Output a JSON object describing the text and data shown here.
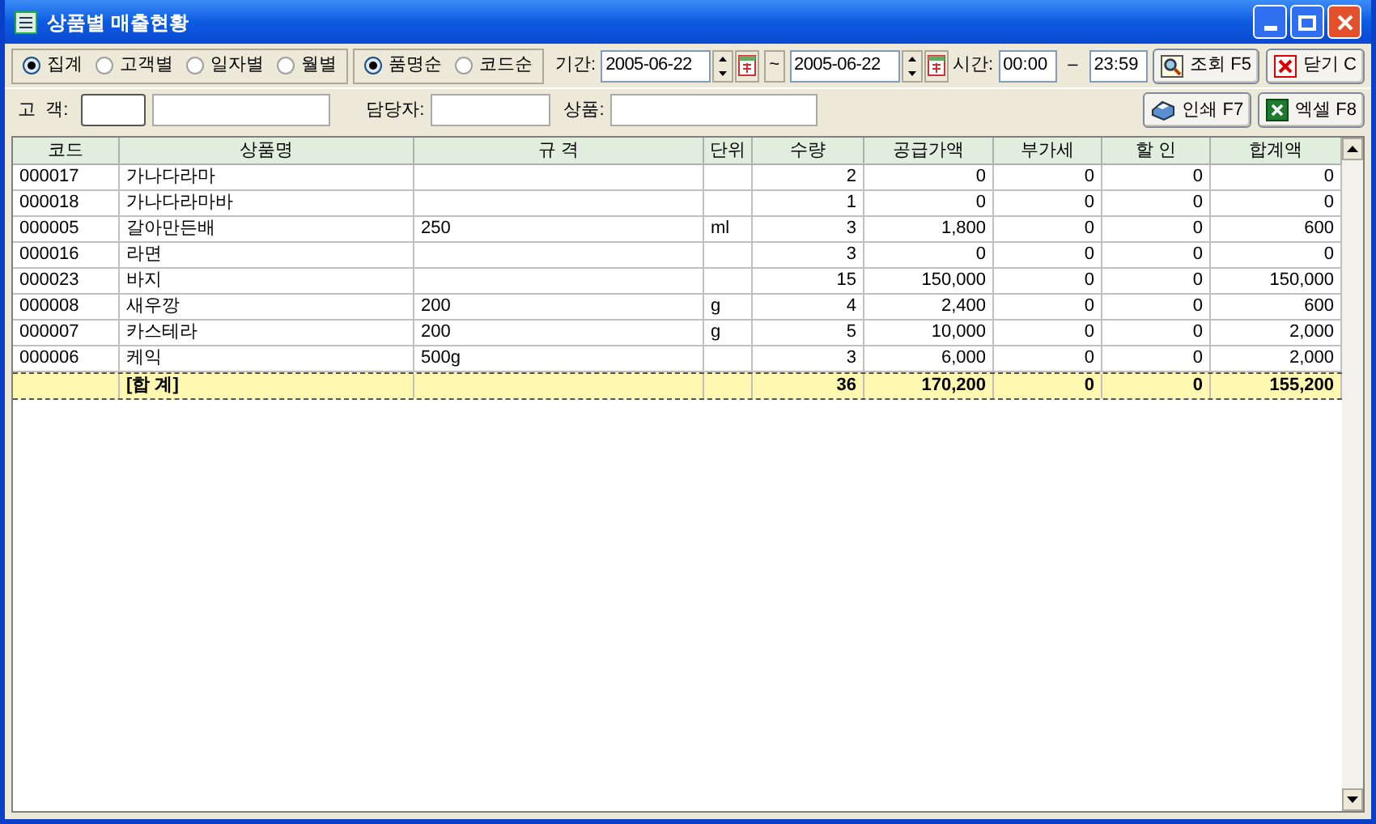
{
  "window": {
    "title": "상품별 매출현황"
  },
  "group_by": [
    {
      "label": "집계",
      "selected": true
    },
    {
      "label": "고객별",
      "selected": false
    },
    {
      "label": "일자별",
      "selected": false
    },
    {
      "label": "월별",
      "selected": false
    }
  ],
  "sort_by": [
    {
      "label": "품명순",
      "selected": true
    },
    {
      "label": "코드순",
      "selected": false
    }
  ],
  "period": {
    "label": "기간:",
    "from": "2005-06-22",
    "separator": "~",
    "to": "2005-06-22"
  },
  "time": {
    "label": "시간:",
    "from": "00:00",
    "separator": "–",
    "to": "23:59"
  },
  "buttons_top": [
    {
      "kind": "search",
      "label": "조회 F5"
    },
    {
      "kind": "close",
      "label": "닫기 C"
    }
  ],
  "customer": {
    "label": "고  객:"
  },
  "manager": {
    "label": "담당자:"
  },
  "product": {
    "label": "상품:"
  },
  "buttons_bottom": [
    {
      "kind": "print",
      "label": "인쇄 F7"
    },
    {
      "kind": "excel",
      "label": "엑셀 F8"
    }
  ],
  "table": {
    "columns": [
      "코드",
      "상품명",
      "규 격",
      "단위",
      "수량",
      "공급가액",
      "부가세",
      "할 인",
      "합계액"
    ],
    "rows": [
      {
        "code": "000017",
        "name": "가나다라마",
        "qty": "2",
        "supply": "0",
        "vat": "0",
        "discount": "0",
        "total": "0"
      },
      {
        "code": "000018",
        "name": "가나다라마바",
        "qty": "1",
        "supply": "0",
        "vat": "0",
        "discount": "0",
        "total": "0"
      },
      {
        "code": "000005",
        "name": "갈아만든배",
        "spec": "250",
        "unit": "ml",
        "qty": "3",
        "supply": "1,800",
        "vat": "0",
        "discount": "0",
        "total": "600"
      },
      {
        "code": "000016",
        "name": "라면",
        "qty": "3",
        "supply": "0",
        "vat": "0",
        "discount": "0",
        "total": "0"
      },
      {
        "code": "000023",
        "name": "바지",
        "qty": "15",
        "supply": "150,000",
        "vat": "0",
        "discount": "0",
        "total": "150,000"
      },
      {
        "code": "000008",
        "name": "새우깡",
        "spec": "200",
        "unit": "g",
        "qty": "4",
        "supply": "2,400",
        "vat": "0",
        "discount": "0",
        "total": "600"
      },
      {
        "code": "000007",
        "name": "카스테라",
        "spec": "200",
        "unit": "g",
        "qty": "5",
        "supply": "10,000",
        "vat": "0",
        "discount": "0",
        "total": "2,000"
      },
      {
        "code": "000006",
        "name": "케익",
        "spec": "500g",
        "qty": "3",
        "supply": "6,000",
        "vat": "0",
        "discount": "0",
        "total": "2,000"
      }
    ],
    "total": {
      "name": "[합 계]",
      "qty": "36",
      "supply": "170,200",
      "vat": "0",
      "discount": "0",
      "total": "155,200"
    }
  }
}
